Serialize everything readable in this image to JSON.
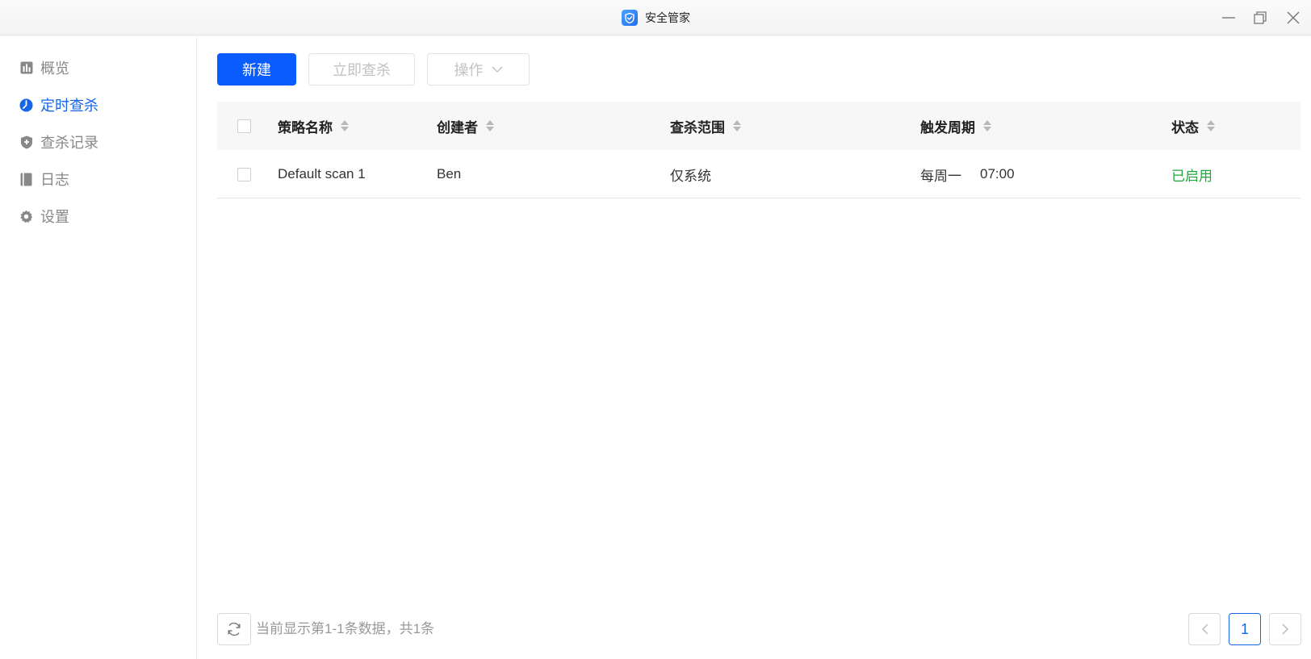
{
  "window": {
    "title": "安全管家"
  },
  "sidebar": {
    "items": [
      {
        "label": "概览",
        "icon": "chart-icon",
        "active": false
      },
      {
        "label": "定时查杀",
        "icon": "clock-icon",
        "active": true
      },
      {
        "label": "查杀记录",
        "icon": "shield-icon",
        "active": false
      },
      {
        "label": "日志",
        "icon": "book-icon",
        "active": false
      },
      {
        "label": "设置",
        "icon": "gear-icon",
        "active": false
      }
    ]
  },
  "toolbar": {
    "new_label": "新建",
    "scan_now_label": "立即查杀",
    "actions_label": "操作"
  },
  "table": {
    "columns": [
      "策略名称",
      "创建者",
      "查杀范围",
      "触发周期",
      "状态"
    ],
    "rows": [
      {
        "name": "Default scan 1",
        "creator": "Ben",
        "scope": "仅系统",
        "period_day": "每周一",
        "period_time": "07:00",
        "status": "已启用"
      }
    ]
  },
  "footer": {
    "info": "当前显示第1-1条数据，共1条",
    "current_page": "1"
  },
  "colors": {
    "accent": "#0a5cff",
    "active_nav": "#1565e8",
    "status_enabled": "#1fa83a"
  }
}
